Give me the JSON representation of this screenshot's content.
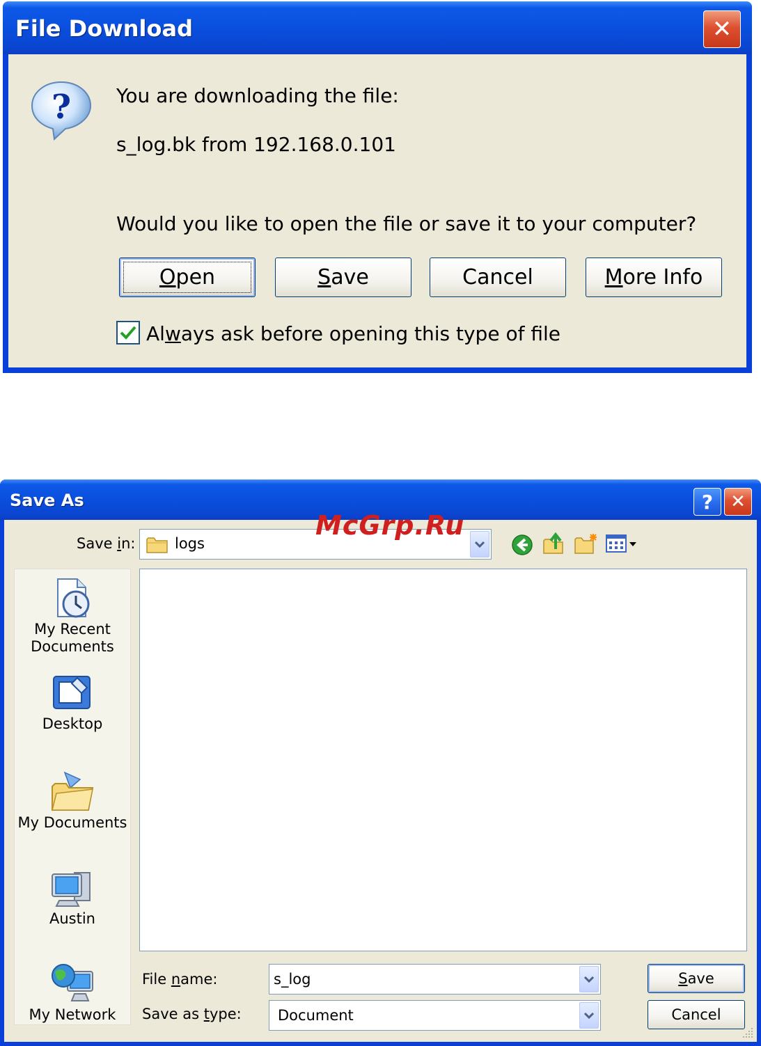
{
  "file_download": {
    "title": "File Download",
    "close_label": "✕",
    "message": "You are downloading the file:",
    "file_info": "s_log.bk from 192.168.0.101",
    "question": "Would you like to open the file or save it to your computer?",
    "buttons": {
      "open_mnemonic": "O",
      "open_rest": "pen",
      "save_mnemonic": "S",
      "save_rest": "ave",
      "cancel": "Cancel",
      "more_mnemonic": "M",
      "more_rest": "ore Info"
    },
    "checkbox": {
      "checked": true,
      "label_pre": "Al",
      "label_mnemonic": "w",
      "label_post": "ays ask before opening this type of file"
    }
  },
  "save_as": {
    "title": "Save As",
    "help_label": "?",
    "close_label": "✕",
    "watermark": "McGrp.Ru",
    "save_in": {
      "pre": "Save ",
      "mnemonic": "i",
      "post": "n:",
      "value": "logs"
    },
    "places": [
      {
        "line1": "My Recent",
        "line2": "Documents"
      },
      {
        "line1": "Desktop",
        "line2": ""
      },
      {
        "line1": "My Documents",
        "line2": ""
      },
      {
        "line1": "Austin",
        "line2": ""
      },
      {
        "line1": "My Network",
        "line2": ""
      }
    ],
    "file_name": {
      "pre": "File ",
      "mnemonic": "n",
      "post": "ame:",
      "value": "s_log"
    },
    "save_type": {
      "pre": "Save as ",
      "mnemonic": "t",
      "post": "ype:",
      "value": "Document"
    },
    "buttons": {
      "save_mnemonic": "S",
      "save_rest": "ave",
      "cancel": "Cancel"
    }
  }
}
